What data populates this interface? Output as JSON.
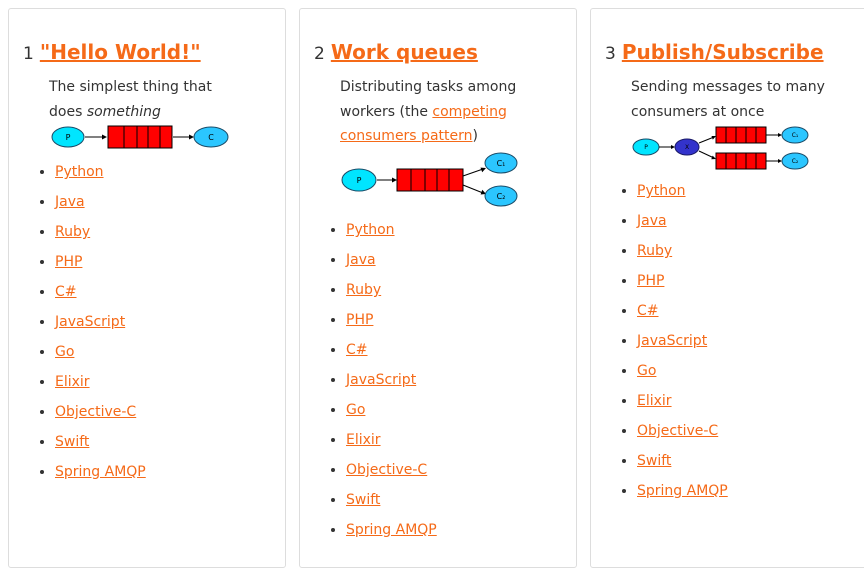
{
  "tutorials": [
    {
      "number": "1",
      "title": "\"Hello World!\"",
      "description": "The simplest thing that does",
      "description_em": "something",
      "diagram": {
        "producer": "P",
        "consumer": "C"
      },
      "languages": [
        "Python",
        "Java",
        "Ruby",
        "PHP",
        "C#",
        "JavaScript",
        "Go",
        "Elixir",
        "Objective-C",
        "Swift",
        "Spring AMQP"
      ]
    },
    {
      "number": "2",
      "title": "Work queues",
      "description_pre": "Distributing tasks among workers (the ",
      "description_link": "competing consumers pattern",
      "description_post": ")",
      "diagram": {
        "producer": "P",
        "consumer_1": "C₁",
        "consumer_2": "C₂"
      },
      "languages": [
        "Python",
        "Java",
        "Ruby",
        "PHP",
        "C#",
        "JavaScript",
        "Go",
        "Elixir",
        "Objective-C",
        "Swift",
        "Spring AMQP"
      ]
    },
    {
      "number": "3",
      "title": "Publish/Subscribe",
      "description": "Sending messages to many consumers at once",
      "diagram": {
        "producer": "P",
        "exchange": "X",
        "consumer_1": "C₁",
        "consumer_2": "C₂"
      },
      "languages": [
        "Python",
        "Java",
        "Ruby",
        "PHP",
        "C#",
        "JavaScript",
        "Go",
        "Elixir",
        "Objective-C",
        "Swift",
        "Spring AMQP"
      ]
    }
  ],
  "colors": {
    "link": "#f56a18",
    "producer": "#00e5ff",
    "consumer": "#2bc6ff",
    "queue": "#ff0000",
    "exchange": "#3333cc"
  }
}
